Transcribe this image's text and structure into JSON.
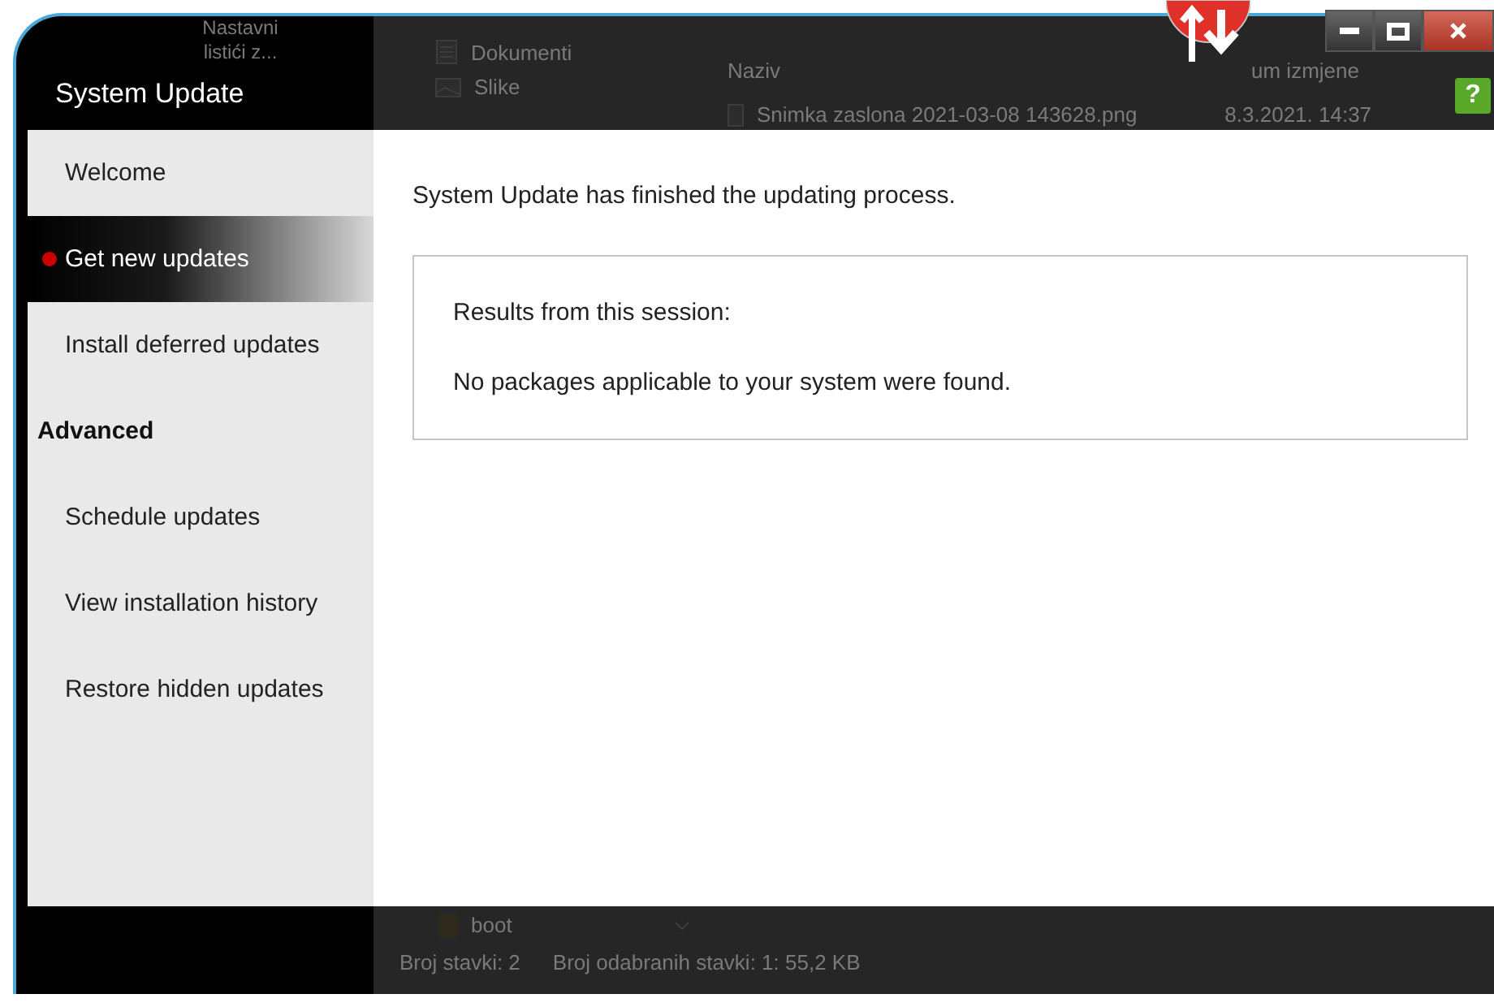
{
  "window": {
    "title": "System Update",
    "help_glyph": "?"
  },
  "background_window": {
    "folder_label": "Nastavni listići z...",
    "quick_access": [
      {
        "label": "Dokumenti",
        "kind": "document"
      },
      {
        "label": "Slike",
        "kind": "image"
      }
    ],
    "columns": [
      "Naziv",
      "um izmjene"
    ],
    "file": {
      "name": "Snimka zaslona 2021-03-08 143628.png",
      "modified": "8.3.2021. 14:37"
    },
    "tree_item": "boot",
    "status": [
      "Broj stavki: 2",
      "Broj odabranih stavki: 1: 55,2 KB"
    ]
  },
  "sidebar": {
    "items": [
      {
        "kind": "item",
        "label": "Welcome",
        "selected": false
      },
      {
        "kind": "item",
        "label": "Get new updates",
        "selected": true
      },
      {
        "kind": "item",
        "label": "Install deferred updates",
        "selected": false
      },
      {
        "kind": "header",
        "label": "Advanced"
      },
      {
        "kind": "item",
        "label": "Schedule updates",
        "selected": false
      },
      {
        "kind": "item",
        "label": "View installation history",
        "selected": false
      },
      {
        "kind": "item",
        "label": "Restore hidden updates",
        "selected": false
      }
    ]
  },
  "content": {
    "message": "System Update has finished the updating process.",
    "results": {
      "title": "Results from this session:",
      "text": "No packages applicable to your system were found."
    }
  }
}
